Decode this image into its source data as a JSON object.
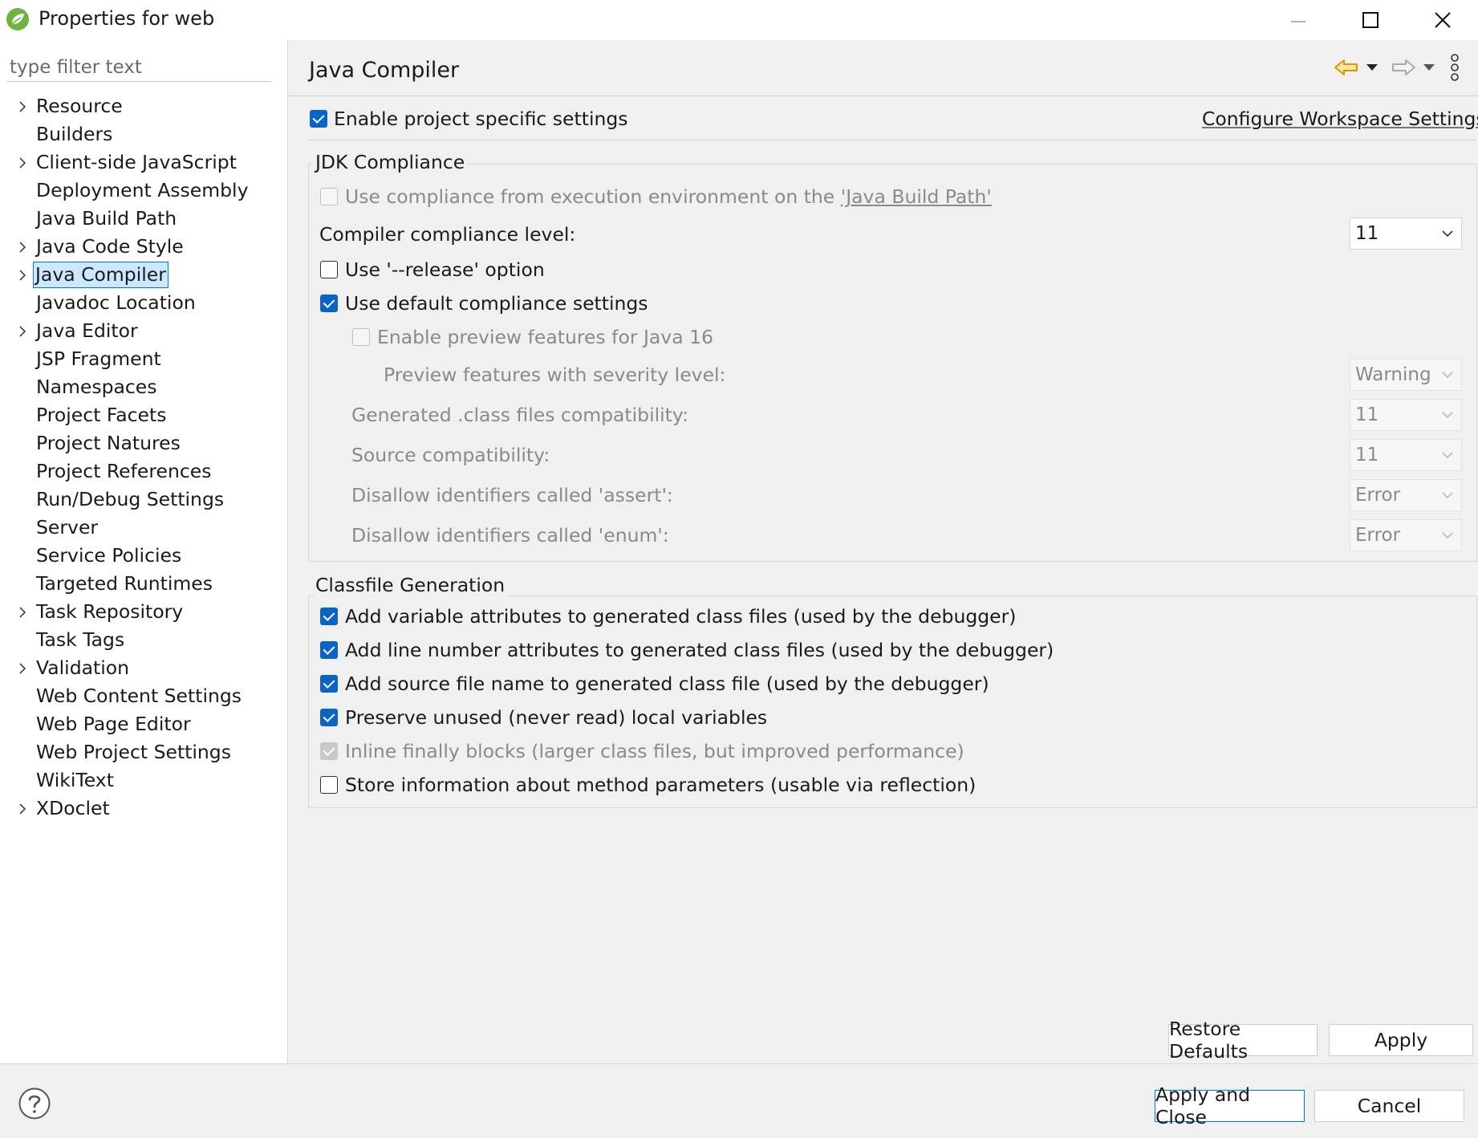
{
  "window": {
    "title": "Properties for web",
    "icons": [
      "spring-leaf-icon",
      "minimize-icon",
      "maximize-icon",
      "close-icon"
    ]
  },
  "sidebar": {
    "filter_placeholder": "type filter text",
    "items": [
      {
        "label": "Resource",
        "expandable": true
      },
      {
        "label": "Builders",
        "expandable": false
      },
      {
        "label": "Client-side JavaScript",
        "expandable": true
      },
      {
        "label": "Deployment Assembly",
        "expandable": false
      },
      {
        "label": "Java Build Path",
        "expandable": false
      },
      {
        "label": "Java Code Style",
        "expandable": true
      },
      {
        "label": "Java Compiler",
        "expandable": true,
        "selected": true
      },
      {
        "label": "Javadoc Location",
        "expandable": false
      },
      {
        "label": "Java Editor",
        "expandable": true
      },
      {
        "label": "JSP Fragment",
        "expandable": false
      },
      {
        "label": "Namespaces",
        "expandable": false
      },
      {
        "label": "Project Facets",
        "expandable": false
      },
      {
        "label": "Project Natures",
        "expandable": false
      },
      {
        "label": "Project References",
        "expandable": false
      },
      {
        "label": "Run/Debug Settings",
        "expandable": false
      },
      {
        "label": "Server",
        "expandable": false
      },
      {
        "label": "Service Policies",
        "expandable": false
      },
      {
        "label": "Targeted Runtimes",
        "expandable": false
      },
      {
        "label": "Task Repository",
        "expandable": true
      },
      {
        "label": "Task Tags",
        "expandable": false
      },
      {
        "label": "Validation",
        "expandable": true
      },
      {
        "label": "Web Content Settings",
        "expandable": false
      },
      {
        "label": "Web Page Editor",
        "expandable": false
      },
      {
        "label": "Web Project Settings",
        "expandable": false
      },
      {
        "label": "WikiText",
        "expandable": false
      },
      {
        "label": "XDoclet",
        "expandable": true
      }
    ]
  },
  "main": {
    "title": "Java Compiler",
    "nav_icons": [
      "back-arrow-icon",
      "back-menu-icon",
      "forward-arrow-icon",
      "forward-menu-icon",
      "more-options-icon"
    ],
    "enable_project_specific": {
      "label": "Enable project specific settings",
      "checked": true
    },
    "configure_workspace_link": "Configure Workspace Settings...",
    "jdk": {
      "title": "JDK Compliance",
      "use_compliance_from_env": {
        "label_prefix": "Use compliance from execution environment on the ",
        "link": "'Java Build Path'",
        "checked": false,
        "enabled": false
      },
      "compliance_level_label": "Compiler compliance level:",
      "compliance_level_value": "11",
      "release_option": {
        "label": "Use '--release' option",
        "checked": false
      },
      "use_default": {
        "label": "Use default compliance settings",
        "checked": true
      },
      "enable_preview": {
        "label": "Enable preview features for Java 16",
        "checked": false,
        "enabled": false
      },
      "preview_severity_label": "Preview features with severity level:",
      "preview_severity_value": "Warning",
      "generated_class_label": "Generated .class files compatibility:",
      "generated_class_value": "11",
      "source_compat_label": "Source compatibility:",
      "source_compat_value": "11",
      "assert_label": "Disallow identifiers called 'assert':",
      "assert_value": "Error",
      "enum_label": "Disallow identifiers called 'enum':",
      "enum_value": "Error"
    },
    "classfile": {
      "title": "Classfile Generation",
      "options": [
        {
          "label": "Add variable attributes to generated class files (used by the debugger)",
          "checked": true,
          "enabled": true
        },
        {
          "label": "Add line number attributes to generated class files (used by the debugger)",
          "checked": true,
          "enabled": true
        },
        {
          "label": "Add source file name to generated class file (used by the debugger)",
          "checked": true,
          "enabled": true
        },
        {
          "label": "Preserve unused (never read) local variables",
          "checked": true,
          "enabled": true
        },
        {
          "label": "Inline finally blocks (larger class files, but improved performance)",
          "checked": true,
          "enabled": false
        },
        {
          "label": "Store information about method parameters (usable via reflection)",
          "checked": false,
          "enabled": true
        }
      ]
    },
    "restore_defaults": "Restore Defaults",
    "apply": "Apply"
  },
  "footer": {
    "help_icon": "help-icon",
    "apply_and_close": "Apply and Close",
    "cancel": "Cancel"
  },
  "colors": {
    "accent": "#0a64c8",
    "selection_bg": "#cce8ff",
    "selection_border": "#0078d7",
    "back_arrow": "#d89a00"
  }
}
